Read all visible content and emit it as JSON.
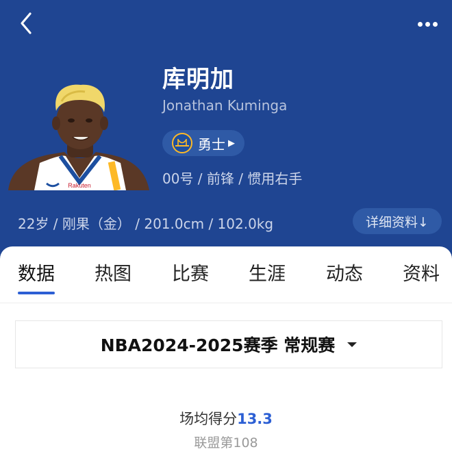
{
  "header": {
    "back_icon": "chevron-left-icon",
    "more_icon": "more-dots-icon"
  },
  "player": {
    "name_cn": "库明加",
    "name_en": "Jonathan Kuminga",
    "team": "勇士",
    "meta": "00号 / 前锋 / 惯用右手",
    "bio": "22岁 / 刚果（金） / 201.0cm / 102.0kg",
    "detail_button": "详细资料↓"
  },
  "tabs": [
    {
      "label": "数据",
      "active": true
    },
    {
      "label": "热图"
    },
    {
      "label": "比赛"
    },
    {
      "label": "生涯"
    },
    {
      "label": "动态"
    },
    {
      "label": "资料"
    }
  ],
  "season_selector": "NBA2024-2025赛季 常规赛",
  "stat": {
    "label": "场均得分",
    "value": "13.3",
    "rank": "联盟第108"
  },
  "colors": {
    "header_bg": "#1f4592",
    "accent": "#2c5fd4",
    "team_gold": "#fdb927"
  }
}
